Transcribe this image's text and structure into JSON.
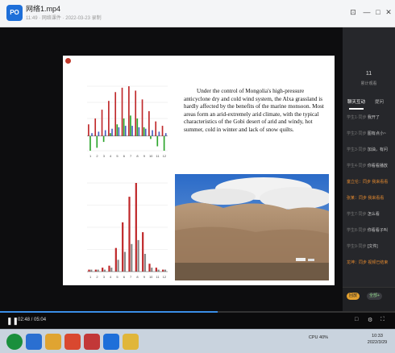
{
  "window": {
    "file_title": "网络1.mp4",
    "file_meta": "11:49  ·  网络课件  ·  2022-03-23 录制",
    "buttons": [
      "⊡",
      "—",
      "□",
      "✕"
    ]
  },
  "slide": {
    "text": "Under the control of Mongolia's high-pressure anticyclone dry and cold wind system, the Alxa grassland is hardly affected by the benefits of the marine monsoon. Most areas form an arid-extremely arid climate, with the typical characteristics of the Gobi desert of arid and windy, hot summer, cold in winter and lack of snow quilts."
  },
  "panel": {
    "count": "11",
    "count_label": "累计观看",
    "tabs": [
      "聊天互动",
      "提问"
    ],
    "messages": [
      {
        "user": "学生1·同步",
        "text": "我开了",
        "style": "normal"
      },
      {
        "user": "学生2·同步",
        "text": "图有点小~",
        "style": "normal"
      },
      {
        "user": "学生3·同步",
        "text": "加油，有问",
        "style": "normal"
      },
      {
        "user": "学生4·同步",
        "text": "你看看播放",
        "style": "normal"
      },
      {
        "user": "童立伦：同步",
        "text": "我来看看",
        "style": "orange"
      },
      {
        "user": "张某：同步",
        "text": "我来看看",
        "style": "orange"
      },
      {
        "user": "学生7·同步",
        "text": "怎么看",
        "style": "normal"
      },
      {
        "user": "学生8·同步",
        "text": "你看看子叫",
        "style": "normal"
      },
      {
        "user": "学生9·同步",
        "text": "[文件]",
        "style": "normal"
      },
      {
        "user": "龙坤：同步",
        "text": "视频已结束",
        "style": "orange"
      }
    ],
    "chips": [
      "回放",
      "全部+"
    ]
  },
  "player": {
    "time": "02:48 / 05:04",
    "progress_fraction": 0.55,
    "icons": [
      "□",
      "⚙",
      "⛶"
    ]
  },
  "taskbar": {
    "icons": [
      {
        "name": "start",
        "color": "#1a8f3c"
      },
      {
        "name": "ie",
        "color": "#2a6fd1"
      },
      {
        "name": "explorer",
        "color": "#e0a431"
      },
      {
        "name": "media",
        "color": "#d9482f"
      },
      {
        "name": "wps",
        "color": "#c23838"
      },
      {
        "name": "app-blue",
        "color": "#1e6fd9"
      },
      {
        "name": "chrome",
        "color": "#e0b63a"
      }
    ],
    "tray": {
      "status": "CPU 40%",
      "clock": "10:33",
      "date": "2022/3/29"
    }
  },
  "chart_data": [
    {
      "type": "bar",
      "note": "upper slide chart: paired red/green/blue bars per month",
      "categories": [
        "1",
        "2",
        "3",
        "4",
        "5",
        "6",
        "7",
        "8",
        "9",
        "10",
        "11",
        "12"
      ],
      "series": [
        {
          "values": [
            8,
            12,
            18,
            24,
            30,
            33,
            34,
            31,
            25,
            17,
            10,
            7
          ],
          "color": "#c0292b"
        },
        {
          "values": [
            -10,
            -8,
            -4,
            2,
            8,
            12,
            14,
            12,
            6,
            -2,
            -7,
            -10
          ],
          "color": "#2ca52c"
        },
        {
          "values": [
            2,
            3,
            4,
            5,
            6,
            7,
            7,
            6,
            5,
            4,
            3,
            2
          ],
          "color": "#4a5fc1"
        }
      ]
    },
    {
      "type": "bar",
      "note": "lower slide chart: red bars with grey partner bars",
      "categories": [
        "1",
        "2",
        "3",
        "4",
        "5",
        "6",
        "7",
        "8",
        "9",
        "10",
        "11",
        "12"
      ],
      "series": [
        {
          "values": [
            1,
            1,
            2,
            3,
            12,
            25,
            38,
            45,
            20,
            4,
            2,
            1
          ],
          "color": "#c0292b"
        },
        {
          "values": [
            1,
            1,
            1,
            2,
            6,
            10,
            14,
            16,
            9,
            2,
            1,
            1
          ],
          "color": "#8a8a8a"
        }
      ]
    }
  ]
}
